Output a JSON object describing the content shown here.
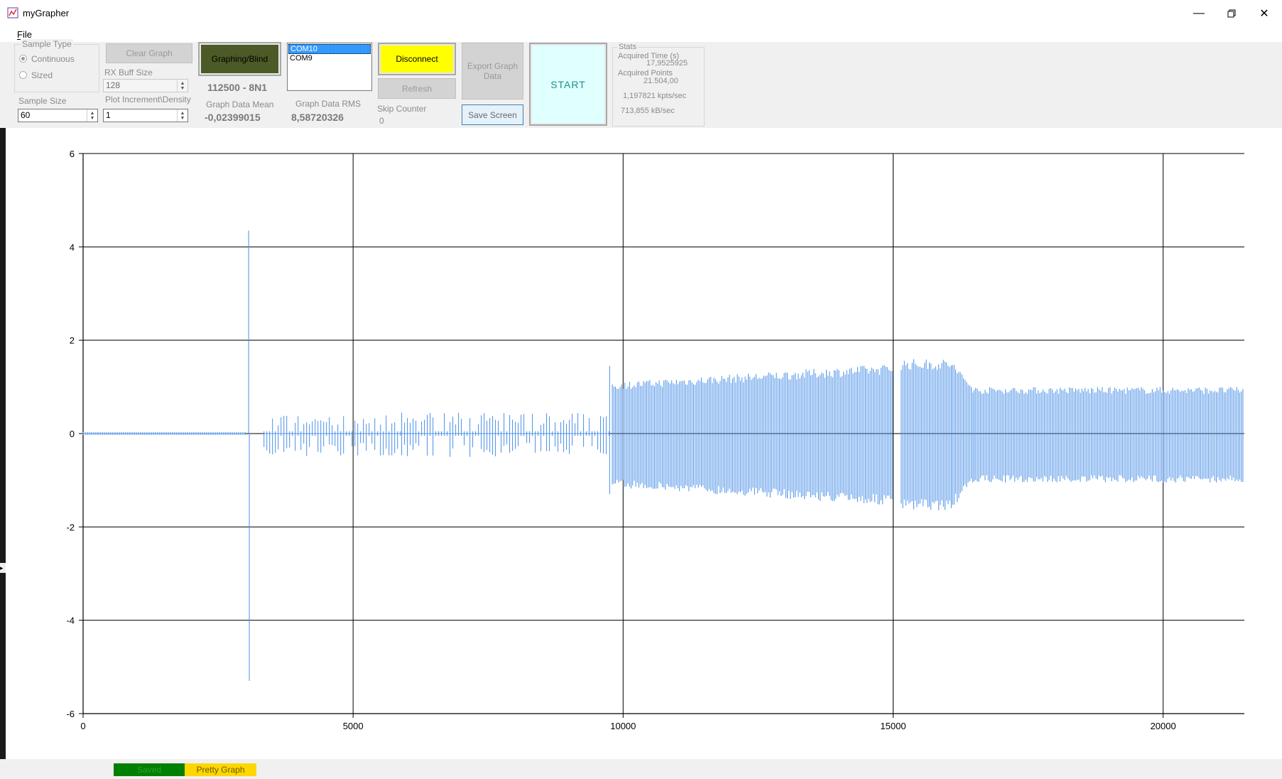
{
  "window": {
    "title": "myGrapher"
  },
  "menu": {
    "file": "File"
  },
  "sample_type": {
    "group_label": "Sample Type",
    "continuous_label": "Continuous",
    "sized_label": "Sized",
    "selected": "Continuous"
  },
  "sample_size": {
    "label": "Sample Size",
    "value": "60"
  },
  "clear_graph": {
    "label": "Clear Graph"
  },
  "rx_buff": {
    "label": "RX Buff Size",
    "value": "128"
  },
  "plot_increment": {
    "label": "Plot Increment\\Density",
    "value": "1"
  },
  "graphing_blind": {
    "label": "Graphing/Blind",
    "color": "#4b5a26"
  },
  "serial_config": "112500 - 8N1",
  "graph_mean": {
    "label": "Graph Data Mean",
    "value": "-0,02399015"
  },
  "graph_rms": {
    "label": "Graph Data RMS",
    "value": "8,58720326"
  },
  "com_ports": {
    "items": [
      "COM10",
      "COM9"
    ],
    "selected": "COM10"
  },
  "disconnect": {
    "label": "Disconnect",
    "color": "#ffff00"
  },
  "refresh": {
    "label": "Refresh"
  },
  "skip_counter": {
    "label": "Skip Counter",
    "value": "0"
  },
  "export": {
    "label": "Export Graph Data"
  },
  "save_screen": {
    "label": "Save Screen"
  },
  "start": {
    "label": "START",
    "color": "#e0ffff"
  },
  "stats": {
    "group_label": "Stats",
    "acquired_time_label": "Acquired Time (s)",
    "acquired_time_value": "17,9525925",
    "acquired_points_label": "Acquired Points",
    "acquired_points_value": "21.504,00",
    "kpts_rate": "1,197821 kpts/sec",
    "kb_rate": "713,855 kB/sec"
  },
  "status": {
    "saved_label": "Saved",
    "saved_color": "#008000",
    "pretty_label": "Pretty Graph",
    "pretty_color": "#ffd700"
  },
  "chart_data": {
    "type": "line",
    "title": "",
    "xlabel": "",
    "ylabel": "",
    "xlim": [
      0,
      21504
    ],
    "ylim": [
      -6,
      6
    ],
    "x_ticks": [
      0,
      5000,
      10000,
      15000,
      20000
    ],
    "y_ticks": [
      -6,
      -4,
      -2,
      0,
      2,
      4,
      6
    ],
    "grid": true,
    "series": [
      {
        "color": "#4a8fe7",
        "segments": [
          {
            "x_start": 0,
            "x_end": 3000,
            "min": -0.05,
            "max": 0.05,
            "pattern": "flat"
          },
          {
            "x_start": 3050,
            "x_end": 3080,
            "min": -5.3,
            "max": 4.35,
            "pattern": "spike"
          },
          {
            "x_start": 3350,
            "x_end": 5900,
            "min": -0.5,
            "max": 0.4,
            "pattern": "sparse"
          },
          {
            "x_start": 5900,
            "x_end": 9750,
            "min": -0.5,
            "max": 0.45,
            "pattern": "sparse"
          },
          {
            "x_start": 9750,
            "x_end": 9800,
            "min": -1.3,
            "max": 1.45,
            "pattern": "edge"
          },
          {
            "x_start": 9800,
            "x_end": 15000,
            "min_start": -1.15,
            "max_start": 1.1,
            "min_end": -1.55,
            "max_end": 1.5,
            "pattern": "dense"
          },
          {
            "x_start": 15150,
            "x_end": 16100,
            "min": -1.65,
            "max": 1.6,
            "pattern": "dense"
          },
          {
            "x_start": 16100,
            "x_end": 16500,
            "min_start": -1.6,
            "max_start": 1.55,
            "min_end": -1.05,
            "max_end": 1.0,
            "pattern": "dense"
          },
          {
            "x_start": 16500,
            "x_end": 21504,
            "min": -1.05,
            "max": 1.0,
            "pattern": "dense"
          }
        ]
      }
    ]
  }
}
